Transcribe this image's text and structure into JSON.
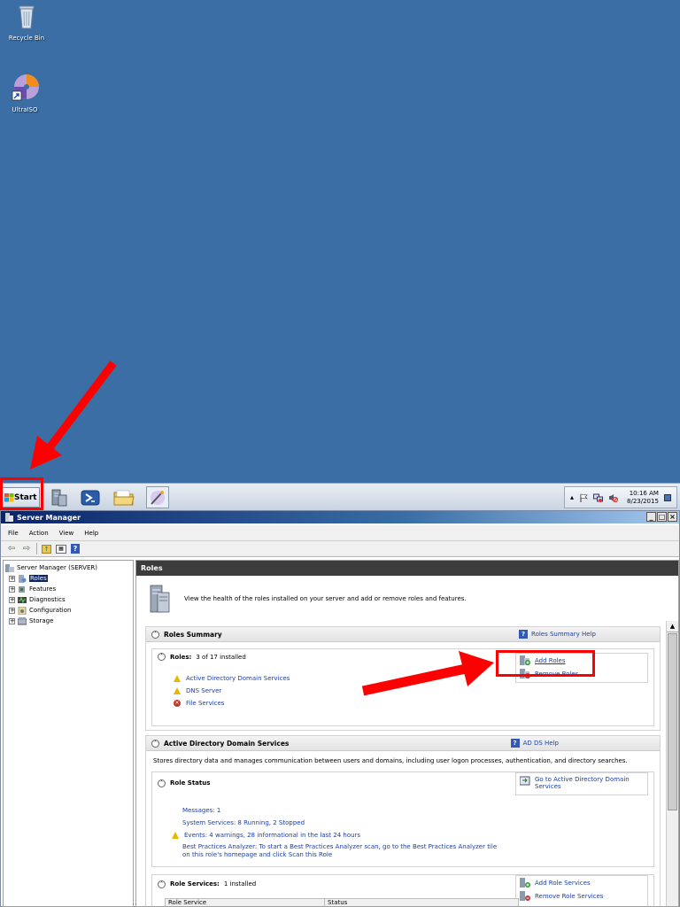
{
  "desktop": {
    "icons": [
      {
        "label": "Recycle Bin"
      },
      {
        "label": "UltraISO"
      }
    ]
  },
  "taskbar": {
    "start_label": "Start",
    "clock_time": "10:16 AM",
    "clock_date": "8/23/2015"
  },
  "window": {
    "title": "Server Manager",
    "menu": [
      "File",
      "Action",
      "View",
      "Help"
    ],
    "tree": {
      "root": "Server Manager (SERVER)",
      "items": [
        "Roles",
        "Features",
        "Diagnostics",
        "Configuration",
        "Storage"
      ]
    },
    "main": {
      "header": "Roles",
      "intro": "View the health of the roles installed on your server and add or remove roles and features.",
      "roles_summary": {
        "title": "Roles Summary",
        "help": "Roles Summary Help",
        "roles_label": "Roles:",
        "roles_count": "3 of 17 installed",
        "roles": [
          {
            "name": "Active Directory Domain Services",
            "status": "warning"
          },
          {
            "name": "DNS Server",
            "status": "warning"
          },
          {
            "name": "File Services",
            "status": "error"
          }
        ],
        "add_roles": "Add Roles",
        "remove_roles": "Remove Roles"
      },
      "adds": {
        "title": "Active Directory Domain Services",
        "help": "AD DS Help",
        "description": "Stores directory data and manages communication between users and domains, including user logon processes, authentication, and directory searches.",
        "role_status": "Role Status",
        "goto": "Go to Active Directory Domain Services",
        "messages": "Messages: 1",
        "system_services": "System Services: 8 Running, 2 Stopped",
        "events": "Events: 4 warnings, 28 informational in the last 24 hours",
        "bpa": "Best Practices Analyzer: To start a Best Practices Analyzer scan, go to the Best Practices Analyzer tile on this role's homepage and click Scan this Role",
        "role_services_label": "Role Services:",
        "role_services_count": "1 installed",
        "add_role_services": "Add Role Services",
        "remove_role_services": "Remove Role Services",
        "table_headers": [
          "Role Service",
          "Status"
        ]
      }
    }
  },
  "colors": {
    "desktop": "#3a6ea5",
    "highlight": "#ff0000"
  }
}
